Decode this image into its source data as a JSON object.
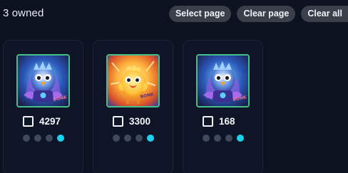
{
  "header": {
    "owned_text": "3 owned"
  },
  "toolbar": {
    "select_page": "Select page",
    "clear_page": "Clear page",
    "clear_all": "Clear all"
  },
  "cards": [
    {
      "id": "4297",
      "art": "blue-bird",
      "selected": false,
      "active_dot": 4,
      "dot_count": 4
    },
    {
      "id": "3300",
      "art": "fire-chick",
      "selected": false,
      "active_dot": 4,
      "dot_count": 4
    },
    {
      "id": "168",
      "art": "blue-bird",
      "selected": false,
      "active_dot": 4,
      "dot_count": 4
    }
  ],
  "colors": {
    "background": "#0b1220",
    "card_background": "#0d1526",
    "thumb_border": "#44c08a",
    "dot_inactive": "#3f4a5e",
    "dot_active": "#19d3ec",
    "button_background": "#3a3f49"
  }
}
